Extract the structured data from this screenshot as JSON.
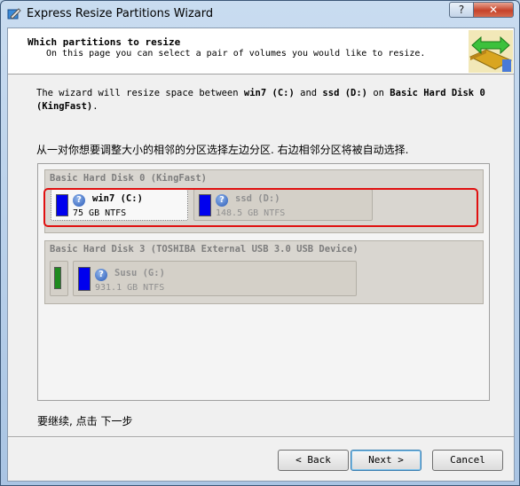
{
  "window": {
    "title": "Express Resize Partitions Wizard",
    "help_label": "?",
    "close_label": "✕"
  },
  "header": {
    "title": "Which partitions to resize",
    "subtitle": "On this page you can select a pair of volumes you would like to resize."
  },
  "description": {
    "prefix": "The wizard will resize space between ",
    "vol1": "win7 (C:)",
    "and": " and ",
    "vol2": "ssd (D:)",
    "on": " on ",
    "disk": "Basic Hard Disk 0 (KingFast)",
    "suffix": "."
  },
  "instruction_cn": "从一对你想要调整大小的相邻的分区选择左边分区. 右边相邻分区将被自动选择.",
  "disks": [
    {
      "label": "Basic Hard Disk 0 (KingFast)",
      "partitions": [
        {
          "name": "win7 (C:)",
          "size": "75 GB NTFS",
          "selected": true
        },
        {
          "name": "ssd (D:)",
          "size": "148.5 GB NTFS",
          "selected": false
        }
      ]
    },
    {
      "label": "Basic Hard Disk 3 (TOSHIBA External USB 3.0 USB Device)",
      "partitions": [
        {
          "name": "Susu (G:)",
          "size": "931.1 GB NTFS",
          "selected": false
        }
      ]
    }
  ],
  "footer_text": "要继续, 点击 下一步",
  "buttons": {
    "back": "< Back",
    "next": "Next >",
    "cancel": "Cancel"
  },
  "colors": {
    "partition_bar": "#0000ee",
    "system_reserved_bar": "#1f8a1f",
    "selection_frame": "#e01010"
  }
}
